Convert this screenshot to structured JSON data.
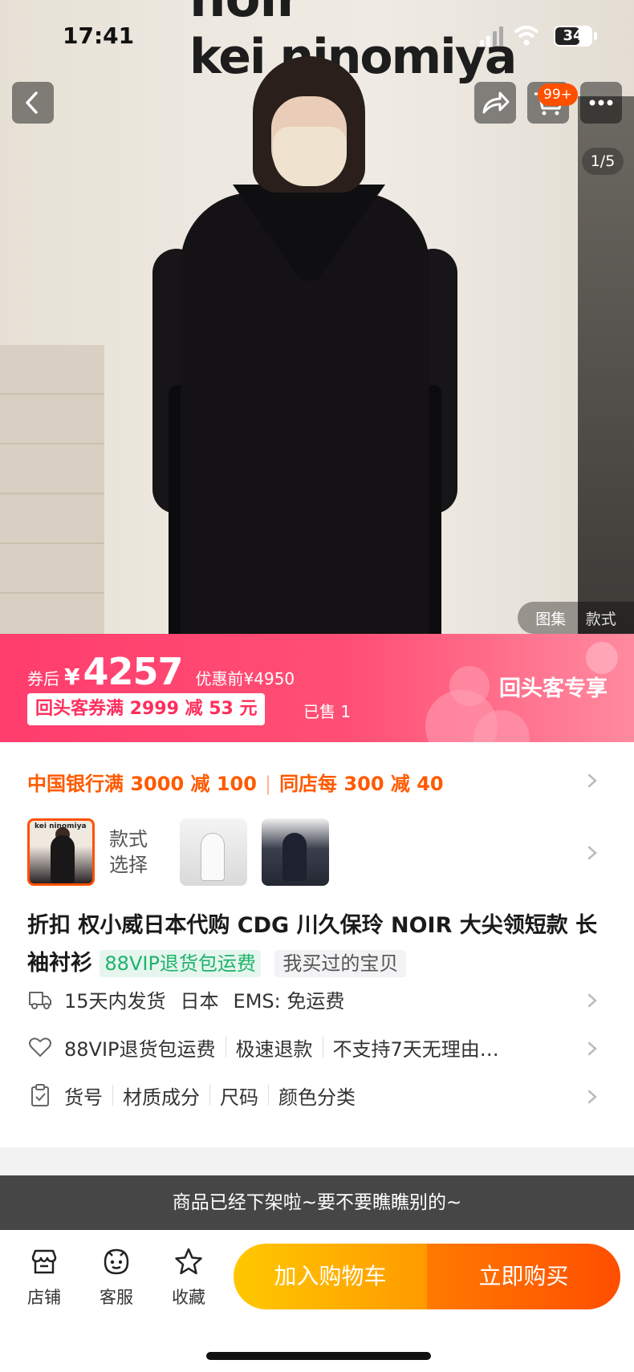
{
  "status_bar": {
    "time": "17:41",
    "battery": "34"
  },
  "hero": {
    "sign_line1": "noir",
    "sign_line2": "kei ninomiya",
    "cart_badge": "99+",
    "pager": "1/5",
    "gallery_tabs": [
      "图集",
      "款式"
    ]
  },
  "price": {
    "after_label": "券后",
    "currency": "¥",
    "value": "4257",
    "original": "优惠前¥4950",
    "coupon": "回头客券满 2999 减 53 元",
    "sold": "已售 1",
    "returning_label": "回头客专享"
  },
  "promo": {
    "bank": "中国银行满 3000 减 100",
    "store": "同店每 300 减 40"
  },
  "style": {
    "label": "款式选择"
  },
  "product": {
    "title": "折扣 权小威日本代购 CDG 川久保玲 NOIR 大尖领短款 长袖衬衫",
    "tag_vip": "88VIP退货包运费",
    "tag_bought": "我买过的宝贝"
  },
  "shipping": {
    "days": "15天内发货",
    "origin": "日本",
    "method": "EMS: 免运费"
  },
  "service": {
    "items": [
      "88VIP退货包运费",
      "极速退款",
      "不支持7天无理由…"
    ]
  },
  "params": {
    "items": [
      "货号",
      "材质成分",
      "尺码",
      "颜色分类"
    ]
  },
  "toast": "商品已经下架啦~要不要瞧瞧别的~",
  "bottom_nav": {
    "store": "店铺",
    "service": "客服",
    "favorite": "收藏"
  },
  "cta": {
    "add_cart": "加入购物车",
    "buy_now": "立即购买"
  },
  "colors": {
    "accent": "#ff5000",
    "price_banner": "#ff3d6e",
    "vip_green": "#1eb36b"
  }
}
